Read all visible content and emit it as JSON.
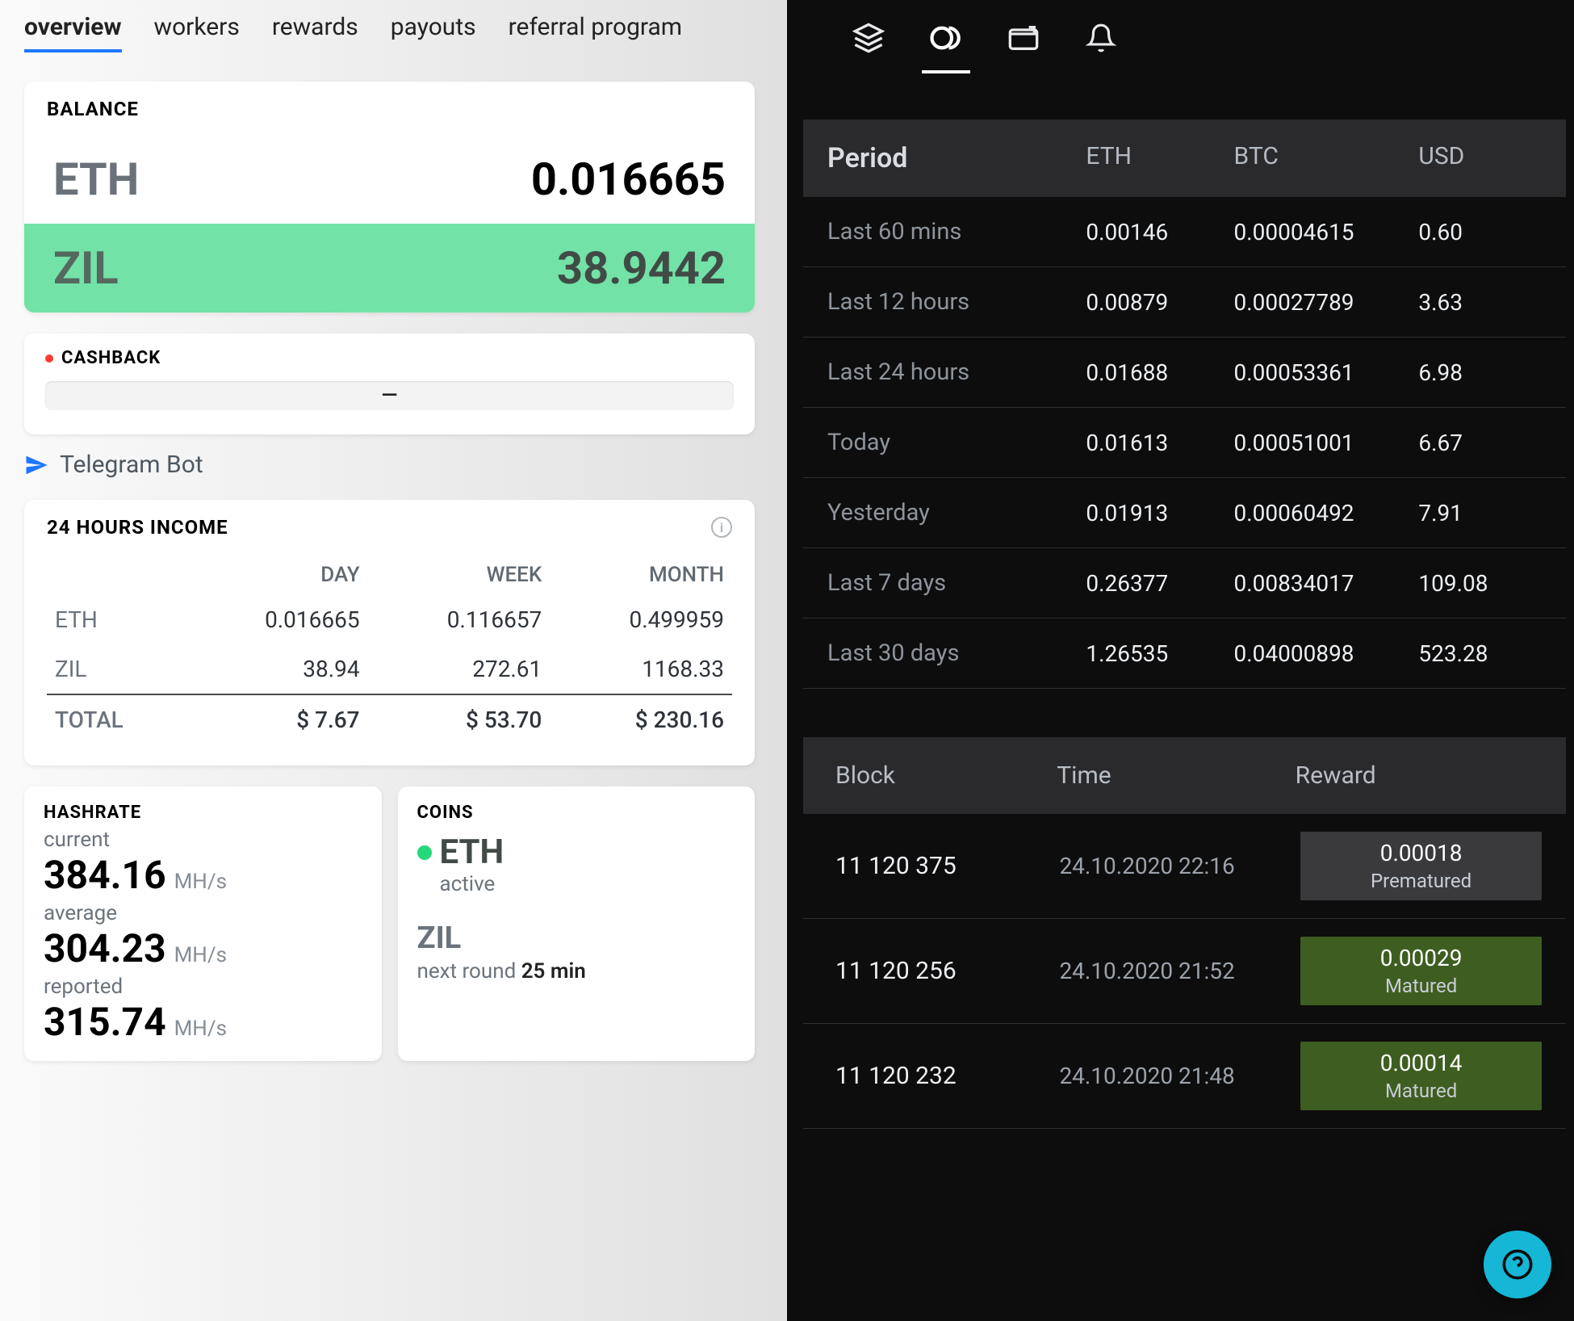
{
  "left": {
    "tabs": [
      "overview",
      "workers",
      "rewards",
      "payouts",
      "referral program"
    ],
    "activeTab": 0,
    "balance": {
      "title": "BALANCE",
      "rows": [
        {
          "symbol": "ETH",
          "value": "0.016665",
          "selected": false
        },
        {
          "symbol": "ZIL",
          "value": "38.9442",
          "selected": true
        }
      ]
    },
    "cashback": {
      "title": "CASHBACK",
      "value": "—"
    },
    "telegram": "Telegram Bot",
    "income": {
      "title": "24 HOURS INCOME",
      "columns": [
        "",
        "DAY",
        "WEEK",
        "MONTH"
      ],
      "rows": [
        {
          "label": "ETH",
          "day": "0.016665",
          "week": "0.116657",
          "month": "0.499959"
        },
        {
          "label": "ZIL",
          "day": "38.94",
          "week": "272.61",
          "month": "1168.33"
        },
        {
          "label": "TOTAL",
          "day": "$ 7.67",
          "week": "$ 53.70",
          "month": "$ 230.16"
        }
      ]
    },
    "hashrate": {
      "title": "HASHRATE",
      "unit": "MH/s",
      "items": [
        {
          "label": "current",
          "value": "384.16"
        },
        {
          "label": "average",
          "value": "304.23"
        },
        {
          "label": "reported",
          "value": "315.74"
        }
      ]
    },
    "coins": {
      "title": "COINS",
      "primary": {
        "symbol": "ETH",
        "status": "active"
      },
      "secondary": {
        "symbol": "ZIL",
        "nextLabel": "next round",
        "nextValue": "25 min"
      }
    }
  },
  "right": {
    "periodHeader": {
      "period": "Period",
      "c1": "ETH",
      "c2": "BTC",
      "c3": "USD"
    },
    "periods": [
      {
        "label": "Last 60 mins",
        "eth": "0.00146",
        "btc": "0.00004615",
        "usd": "0.60"
      },
      {
        "label": "Last 12 hours",
        "eth": "0.00879",
        "btc": "0.00027789",
        "usd": "3.63"
      },
      {
        "label": "Last 24 hours",
        "eth": "0.01688",
        "btc": "0.00053361",
        "usd": "6.98"
      },
      {
        "label": "Today",
        "eth": "0.01613",
        "btc": "0.00051001",
        "usd": "6.67"
      },
      {
        "label": "Yesterday",
        "eth": "0.01913",
        "btc": "0.00060492",
        "usd": "7.91"
      },
      {
        "label": "Last 7 days",
        "eth": "0.26377",
        "btc": "0.00834017",
        "usd": "109.08"
      },
      {
        "label": "Last 30 days",
        "eth": "1.26535",
        "btc": "0.04000898",
        "usd": "523.28"
      }
    ],
    "blocksHeader": {
      "block": "Block",
      "time": "Time",
      "reward": "Reward"
    },
    "blocks": [
      {
        "num": "11 120 375",
        "time": "24.10.2020 22:16",
        "reward": "0.00018",
        "status": "Prematured"
      },
      {
        "num": "11 120 256",
        "time": "24.10.2020 21:52",
        "reward": "0.00029",
        "status": "Matured"
      },
      {
        "num": "11 120 232",
        "time": "24.10.2020 21:48",
        "reward": "0.00014",
        "status": "Matured"
      }
    ]
  }
}
